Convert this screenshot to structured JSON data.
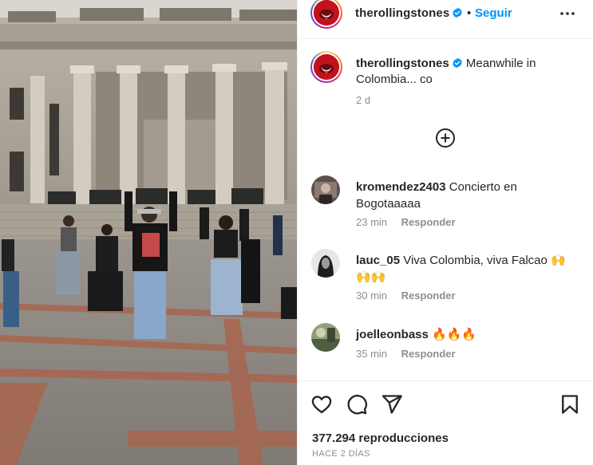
{
  "post": {
    "username": "therollingstones",
    "follow_label": "Seguir",
    "separator": "•"
  },
  "caption": {
    "username": "therollingstones",
    "text": "Meanwhile in Colombia... co",
    "time": "2 d"
  },
  "comments": [
    {
      "username": "kromendez2403",
      "text": "Concierto en Bogotaaaaa",
      "time": "23 min",
      "reply_label": "Responder",
      "avatar_color": "#6b5b55"
    },
    {
      "username": "lauc_05",
      "text": "Viva Colombia, viva Falcao 🙌🙌🙌",
      "time": "30 min",
      "reply_label": "Responder",
      "avatar_color": "#3a3a3a"
    },
    {
      "username": "joelleonbass",
      "text": "🔥🔥🔥",
      "time": "35 min",
      "reply_label": "Responder",
      "avatar_color": "#6f7e5a"
    }
  ],
  "stats": {
    "views": "377.294 reproducciones",
    "posted_ago": "HACE 2 DÍAS"
  },
  "icons": {
    "verified": "verified-badge-icon",
    "more": "more-options-icon",
    "load_more": "plus-circle-icon",
    "like": "heart-icon",
    "comment": "comment-icon",
    "share": "paper-plane-icon",
    "save": "bookmark-icon"
  },
  "colors": {
    "link": "#0095f6",
    "verified": "#0095f6",
    "muted": "#8e8e8e",
    "text": "#262626"
  }
}
